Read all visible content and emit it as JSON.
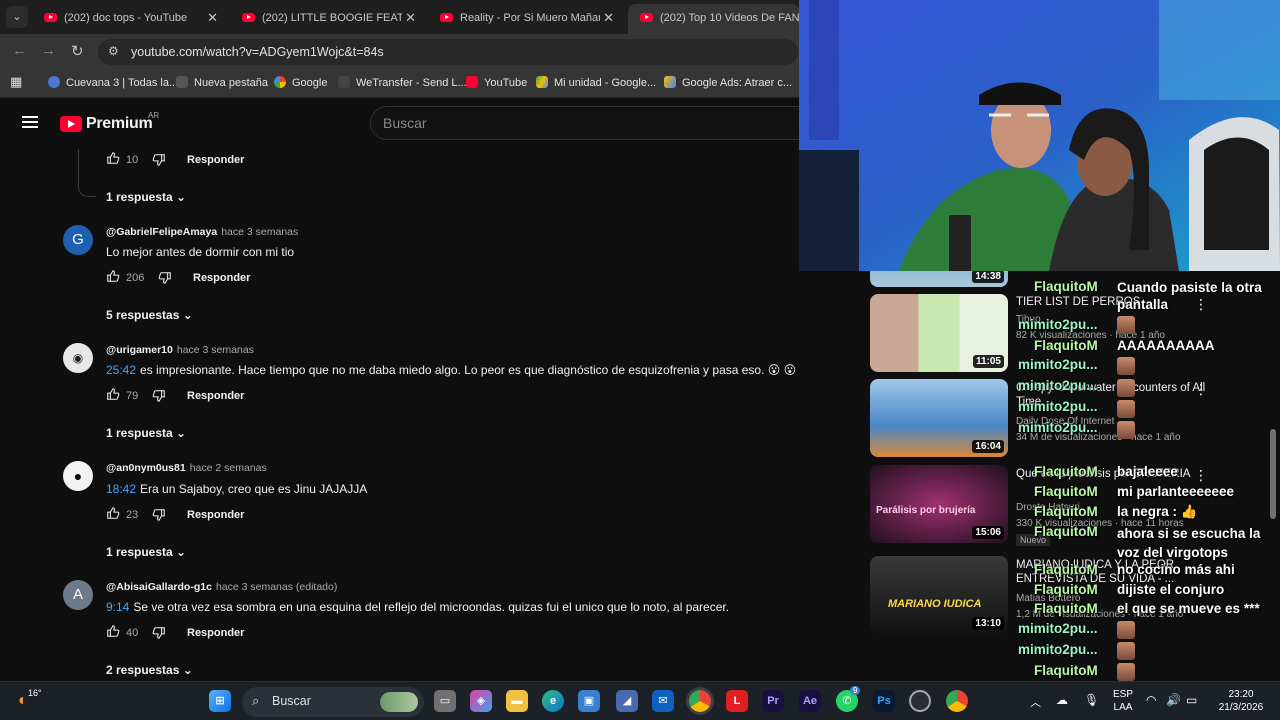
{
  "browser": {
    "tabs": [
      {
        "title": "(202) doc tops - YouTube",
        "active": false
      },
      {
        "title": "(202) LITTLE BOOGIE FEAT. MILA",
        "active": false
      },
      {
        "title": "Reality - Por Si Muero Mañana",
        "active": false
      },
      {
        "title": "(202) Top 10 Videos De FANTASMAS",
        "active": true
      }
    ],
    "url": "youtube.com/watch?v=ADGyem1Wojc&t=84s",
    "bookmarks": [
      "Cuevana 3 | Todas la...",
      "Nueva pestaña",
      "Google",
      "WeTransfer - Send L...",
      "YouTube",
      "Mi unidad - Google...",
      "Google Ads: Atraer c..."
    ]
  },
  "youtube": {
    "brand": "Premium",
    "country": "AR",
    "search_placeholder": "Buscar"
  },
  "comments": {
    "reply_label": "Responder",
    "top_partial": {
      "likes": "10",
      "replies": "1 respuesta"
    },
    "items": [
      {
        "avatar_letter": "G",
        "avatar_color": "#1e5fb0",
        "author": "@GabrielFelipeAmaya",
        "date": "hace 3 semanas",
        "timestamp": "",
        "text": "Lo mejor antes de dormir con mi tio",
        "likes": "206",
        "replies": "5 respuestas"
      },
      {
        "avatar_letter": "",
        "avatar_color": "#ddd",
        "author": "@urigamer10",
        "date": "hace 3 semanas",
        "timestamp": "25:42",
        "text": "es impresionante. Hace tiempo que no me daba miedo algo. Lo peor es que diagnóstico de esquizofrenia y pasa eso. 😮 😮",
        "likes": "79",
        "replies": "1 respuesta"
      },
      {
        "avatar_letter": "",
        "avatar_color": "#222",
        "author": "@an0nym0us81",
        "date": "hace 2 semanas",
        "timestamp": "18:42",
        "text": "Era un Sajaboy, creo que es Jinu JAJAJJA",
        "likes": "23",
        "replies": "1 respuesta"
      },
      {
        "avatar_letter": "A",
        "avatar_color": "#6c7a89",
        "author": "@AbisaiGallardo-g1c",
        "date": "hace 3 semanas (editado)",
        "timestamp": "9:14",
        "text": "Se ve otra vez esa sombra en una esquina del reflejo del microondas. quizas fui el unico que lo noto, al parecer.",
        "likes": "40",
        "replies": "2 respuestas"
      }
    ]
  },
  "related": [
    {
      "duration": "14:38",
      "title": "",
      "channel": "",
      "meta": ""
    },
    {
      "duration": "11:05",
      "title": "TIER LIST DE PERROS",
      "channel": "Tibuo",
      "meta": "82 K visualizaciones · hace 1 año",
      "thumb_text": "TIER LIST DE PERROS"
    },
    {
      "duration": "16:04",
      "title": "Creepy Underwater Encounters of All Time",
      "channel": "Daily Dose Of Internet",
      "meta": "34 M de visualizaciones · hace 1 año"
    },
    {
      "duration": "15:06",
      "title": "Que es la parálisis por BRUJERIA",
      "channel": "Droste Hatsuri",
      "meta": "330 K visualizaciones · hace 11 horas",
      "badge": "Nuevo",
      "thumb_text": "Parálisis por brujería"
    },
    {
      "duration": "13:10",
      "title": "MARIANO IUDICA Y LA PEOR ENTREVISTA DE SU VIDA - ...",
      "channel": "Matias Bottero",
      "meta": "1,2 M de visualizaciones · hace 1 año",
      "thumb_text": "MARIANO IUDICA"
    }
  ],
  "chat": [
    {
      "user": "FlaquitoM",
      "msg": "Cuando pasiste la otra pantalla"
    },
    {
      "user": "mimito2pu...",
      "msg": ""
    },
    {
      "user": "FlaquitoM",
      "msg": "AAAAAAAAAA"
    },
    {
      "user": "mimito2pu...",
      "msg": ""
    },
    {
      "user": "mimito2pu...",
      "msg": ""
    },
    {
      "user": "mimito2pu...",
      "msg": ""
    },
    {
      "user": "mimito2pu...",
      "msg": ""
    },
    {
      "user": "FlaquitoM",
      "msg": "bajaleeee"
    },
    {
      "user": "FlaquitoM",
      "msg": "mi parlanteeeeeee"
    },
    {
      "user": "FlaquitoM",
      "msg": "la negra : 👍"
    },
    {
      "user": "FlaquitoM",
      "msg": "ahora si se escucha la voz del virgotops"
    },
    {
      "user": "FlaquitoM",
      "msg": "no cocino más ahi"
    },
    {
      "user": "FlaquitoM",
      "msg": "dijiste el conjuro"
    },
    {
      "user": "FlaquitoM",
      "msg": "el que se mueve es ***"
    },
    {
      "user": "mimito2pu...",
      "msg": ""
    },
    {
      "user": "mimito2pu...",
      "msg": ""
    },
    {
      "user": "FlaquitoM",
      "msg": ""
    }
  ],
  "taskbar": {
    "weather": "16°",
    "search": "Buscar",
    "lang": "ESP",
    "lang2": "LAA",
    "time": "23:20",
    "date": "21/3/2026",
    "whatsapp_badge": "9"
  },
  "colors": {
    "accent": "#ff0033",
    "link": "#3ea6ff",
    "chat_name": "#9cf5c2"
  }
}
